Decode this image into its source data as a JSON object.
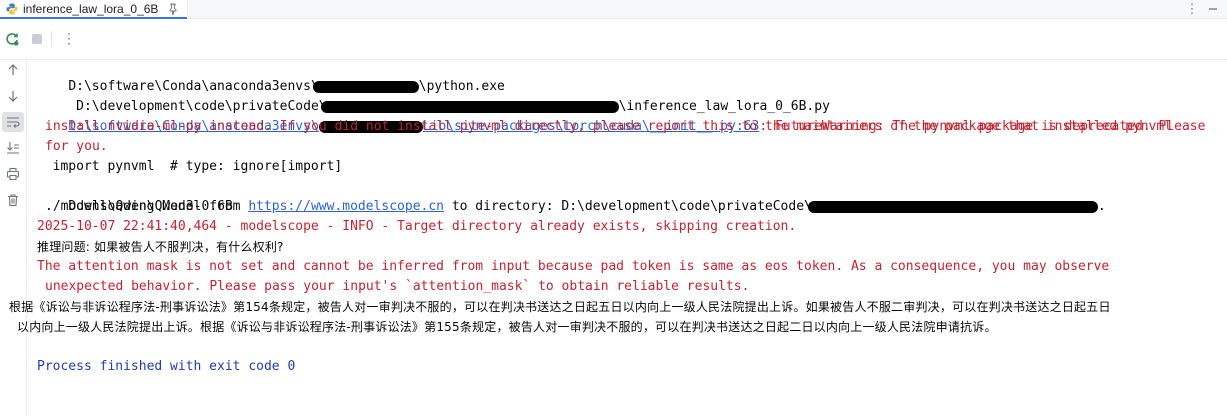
{
  "tab": {
    "title": "inference_law_lora_0_6B",
    "icon": "python-file-icon",
    "pin_icon": "pin-icon"
  },
  "toolbar": {
    "rerun_icon": "rerun-icon",
    "stop_icon": "stop-icon",
    "more_icon": "more-vertical-icon"
  },
  "gutter": {
    "icons": [
      "arrow-up-icon",
      "arrow-down-icon",
      "soft-wrap-icon",
      "scroll-to-end-icon",
      "print-icon",
      "trash-icon"
    ]
  },
  "console": {
    "l1_prefix": "D:\\software\\Conda\\anaconda3envs\\",
    "l1_suffix": "\\python.exe",
    "l2_prefix": " D:\\development\\code\\privateCode\\",
    "l2_suffix": "\\inference_law_lora_0_6B.py",
    "l3_link_a": "D:\\software\\Conda\\anaconda3envs\\",
    "l3_link_b": "Lib\\site-packages\\torch\\cuda\\__init__.py:63",
    "l3_msg": ": FutureWarning: The pynvml package is deprecated. Please",
    "l4": "install nvidia-ml-py instead. If you did not install pynvml directly, please report this to the maintainers of the package that installed pynvml",
    "l5": "for you.",
    "l6": "  import pynvml  # type: ignore[import]",
    "l7_prefix": "Downloading Model from ",
    "l7_link": "https://www.modelscope.cn",
    "l7_mid": " to directory: D:\\development\\code\\privateCode\\",
    "l7_suffix": ".",
    "l8": "./models\\Qwen\\Qwen3-0.6B",
    "l9": "2025-10-07 22:41:40,464 - modelscope - INFO - Target directory already exists, skipping creation.",
    "l10": "推理问题: 如果被告人不服判决，有什么权利?",
    "l11": "The attention mask is not set and cannot be inferred from input because pad token is same as eos token. As a consequence, you may observe",
    "l12": "unexpected behavior. Please pass your input's `attention_mask` to obtain reliable results.",
    "l13": "根据《诉讼与非诉讼程序法-刑事诉讼法》第154条规定，被告人对一审判决不服的，可以在判决书送达之日起五日以内向上一级人民法院提出上诉。如果被告人不服二审判决，可以在判决书送达之日起五日",
    "l14": "以内向上一级人民法院提出上诉。根据《诉讼与非诉讼程序法-刑事诉讼法》第155条规定，被告人对一审判决不服的，可以在判决书送达之日起二日以内向上一级人民法院申请抗诉。",
    "l16": "Process finished with exit code 0"
  },
  "colors": {
    "error_red": "#c7222d",
    "link_blue": "#2a62d9",
    "exit_blue": "#1f3db8",
    "redaction": "#000000"
  }
}
